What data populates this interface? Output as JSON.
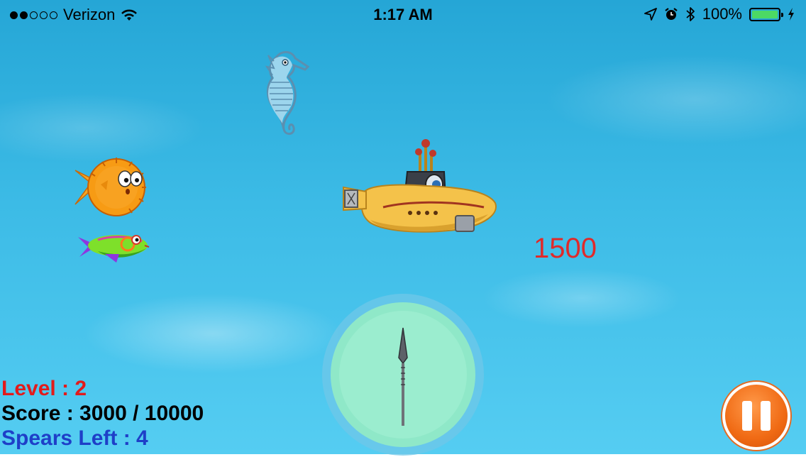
{
  "status_bar": {
    "signal_dots_filled": 2,
    "signal_dots_total": 5,
    "carrier": "Verizon",
    "wifi_icon": "wifi-icon",
    "time": "1:17 AM",
    "location_icon": "location-arrow-icon",
    "alarm_icon": "alarm-clock-icon",
    "bluetooth_icon": "bluetooth-icon",
    "battery_percent": "100%",
    "battery_level": 1.0,
    "charging_icon": "bolt-icon"
  },
  "game": {
    "floating_points": "1500",
    "sprites": [
      "seahorse",
      "pufferfish",
      "tropical-fish",
      "yellow-submarine",
      "spear",
      "spear-launcher-circle"
    ]
  },
  "hud": {
    "level": "Level : 2",
    "score": "Score : 3000 / 10000",
    "spears_left": "Spears Left : 4"
  },
  "colors": {
    "level": "#e31b1b",
    "score": "#000000",
    "spears_left": "#1e3fc8",
    "floating_points": "#e02a2a",
    "pause_button": "#f06a14"
  },
  "controls": {
    "pause_icon": "pause-icon"
  }
}
